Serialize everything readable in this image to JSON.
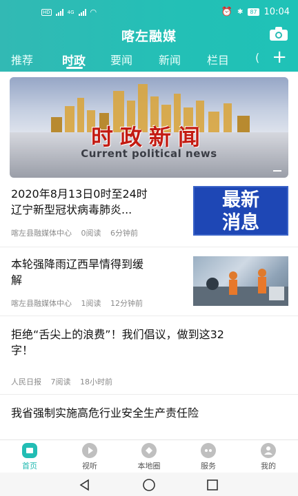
{
  "status_bar": {
    "time": "10:04",
    "battery": "87",
    "network": "4G"
  },
  "header": {
    "app_title": "喀左融媒"
  },
  "tabs": [
    {
      "label": "推荐"
    },
    {
      "label": "时政"
    },
    {
      "label": "要闻"
    },
    {
      "label": "新闻"
    },
    {
      "label": "栏目"
    },
    {
      "label": "("
    }
  ],
  "active_tab": "时政",
  "banner": {
    "title": "时政新闻",
    "subtitle": "Current political news"
  },
  "news": [
    {
      "title_line1": "2020年8月13日0时至24时",
      "title_line2": "辽宁新型冠状病毒肺炎...",
      "source": "喀左县融媒体中心",
      "reads": "0阅读",
      "time": "6分钟前",
      "thumb_text_1": "最新",
      "thumb_text_2": "消息"
    },
    {
      "title_line1": "本轮强降雨辽西旱情得到缓",
      "title_line2": "解",
      "source": "喀左县融媒体中心",
      "reads": "1阅读",
      "time": "12分钟前"
    },
    {
      "title_line1": "拒绝“舌尖上的浪费”！我们倡议，做到这32",
      "title_line2": "字！",
      "source": "人民日报",
      "reads": "7阅读",
      "time": "18小时前"
    },
    {
      "title_line1": "我省强制实施高危行业安全生产责任险"
    }
  ],
  "bottom_nav": [
    {
      "label": "首页",
      "icon": "home-icon"
    },
    {
      "label": "视听",
      "icon": "play-icon"
    },
    {
      "label": "本地圈",
      "icon": "local-icon"
    },
    {
      "label": "服务",
      "icon": "service-icon"
    },
    {
      "label": "我的",
      "icon": "profile-icon"
    }
  ],
  "colors": {
    "accent": "#22bdb4",
    "banner_red": "#c31b12",
    "thumb_blue": "#1e47b5"
  }
}
